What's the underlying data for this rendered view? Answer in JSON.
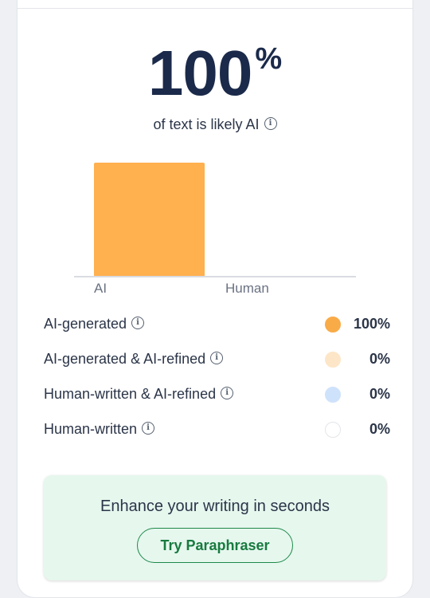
{
  "score": {
    "value": "100",
    "unit": "%",
    "subtitle": "of text is likely AI"
  },
  "chart_data": {
    "type": "bar",
    "categories": [
      "AI",
      "Human"
    ],
    "values": [
      100,
      0
    ],
    "ylim": [
      0,
      100
    ],
    "bar_color": "#ffb04f",
    "axis_color": "#d9dce2"
  },
  "legend": [
    {
      "label": "AI-generated",
      "value": "100%",
      "color": "#f9ab48",
      "border": "#f9ab48"
    },
    {
      "label": "AI-generated & AI-refined",
      "value": "0%",
      "color": "#fde6c8",
      "border": "#fde6c8"
    },
    {
      "label": "Human-written & AI-refined",
      "value": "0%",
      "color": "#cfe2fb",
      "border": "#cfe2fb"
    },
    {
      "label": "Human-written",
      "value": "0%",
      "color": "#ffffff",
      "border": "#e3e5e9"
    }
  ],
  "cta": {
    "text": "Enhance your writing in seconds",
    "button_label": "Try Paraphraser"
  }
}
